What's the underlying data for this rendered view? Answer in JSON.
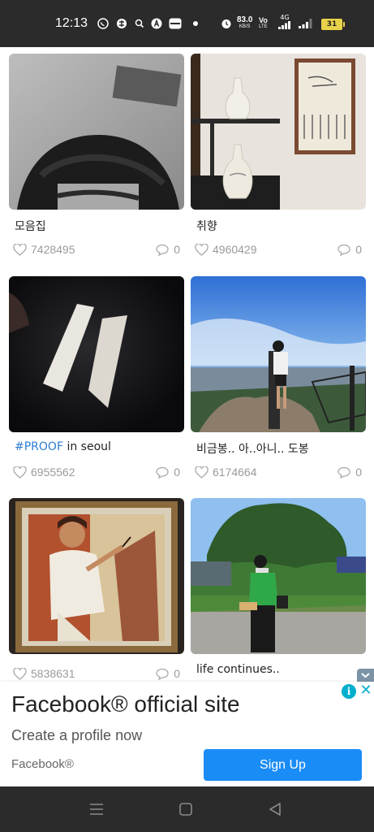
{
  "status_bar": {
    "time": "12:13",
    "net_speed_value": "83.0",
    "net_speed_unit": "KB/S",
    "lte_top": "Vo",
    "lte_bottom": "LTE",
    "network_type": "4G",
    "battery": "31",
    "icons": [
      "whatsapp-icon",
      "browser-icon",
      "search-icon",
      "app-icon",
      "card-icon",
      "dot-icon",
      "alarm-icon",
      "signal-icon",
      "signal-icon-2",
      "battery-icon"
    ]
  },
  "posts": [
    {
      "title": "모음집",
      "likes": "7428495",
      "comments": "0"
    },
    {
      "title": "취향",
      "likes": "4960429",
      "comments": "0"
    },
    {
      "title_tag": "#PROOF",
      "title_rest": " in seoul",
      "likes": "6955562",
      "comments": "0"
    },
    {
      "title": "비금봉.. 아..아니.. 도봉",
      "likes": "6174664",
      "comments": "0"
    },
    {
      "title": "",
      "likes": "5838631",
      "comments": "0"
    },
    {
      "title": "life continues..",
      "likes": "",
      "comments": ""
    }
  ],
  "ad": {
    "headline": "Facebook® official site",
    "subtext": "Create a profile now",
    "brand": "Facebook®",
    "cta": "Sign Up",
    "info_glyph": "i",
    "close_glyph": "✕"
  },
  "colors": {
    "hashtag": "#2e7dd1",
    "cta": "#1a8cf5",
    "adchoices": "#00aecd",
    "bars": "#2b2b2b"
  }
}
